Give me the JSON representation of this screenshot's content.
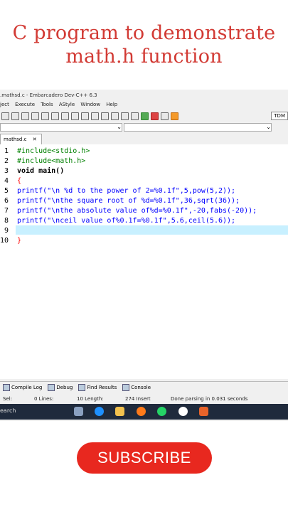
{
  "title_lines": [
    "C program to demonstrate",
    "math.h function"
  ],
  "window_title": ".mathsd.c - Embarcadero Dev-C++ 6.3",
  "menu": [
    "ject",
    "Execute",
    "Tools",
    "AStyle",
    "Window",
    "Help"
  ],
  "toolbar_right": "TDM",
  "combo_arrow": "⌄",
  "tab": {
    "label": "mathsd.c",
    "close": "✕"
  },
  "line_numbers": [
    "1",
    "2",
    "3",
    "4",
    "5",
    "6",
    "7",
    "8",
    "9",
    "10"
  ],
  "code": [
    "#include<stdio.h>",
    "#include<math.h>",
    "void main()",
    "{",
    "printf(\"\\n %d to the power of 2=%0.1f\",5,pow(5,2));",
    "printf(\"\\nthe square root of %d=%0.1f\",36,sqrt(36));",
    "printf(\"\\nthe absolute value of%d=%0.1f\",-20,fabs(-20));",
    "printf(\"\\nceil value of%0.1f=%0.1f\",5.6,ceil(5.6));",
    "",
    "}"
  ],
  "bottom_tabs": [
    "Compile Log",
    "Debug",
    "Find Results",
    "Console"
  ],
  "status": {
    "sel": "Sel:",
    "lines": "0 Lines:",
    "length": "10 Length:",
    "insert": "274 Insert",
    "message": "Done parsing in 0.031 seconds"
  },
  "search_label": "earch",
  "subscribe": "SUBSCRIBE"
}
